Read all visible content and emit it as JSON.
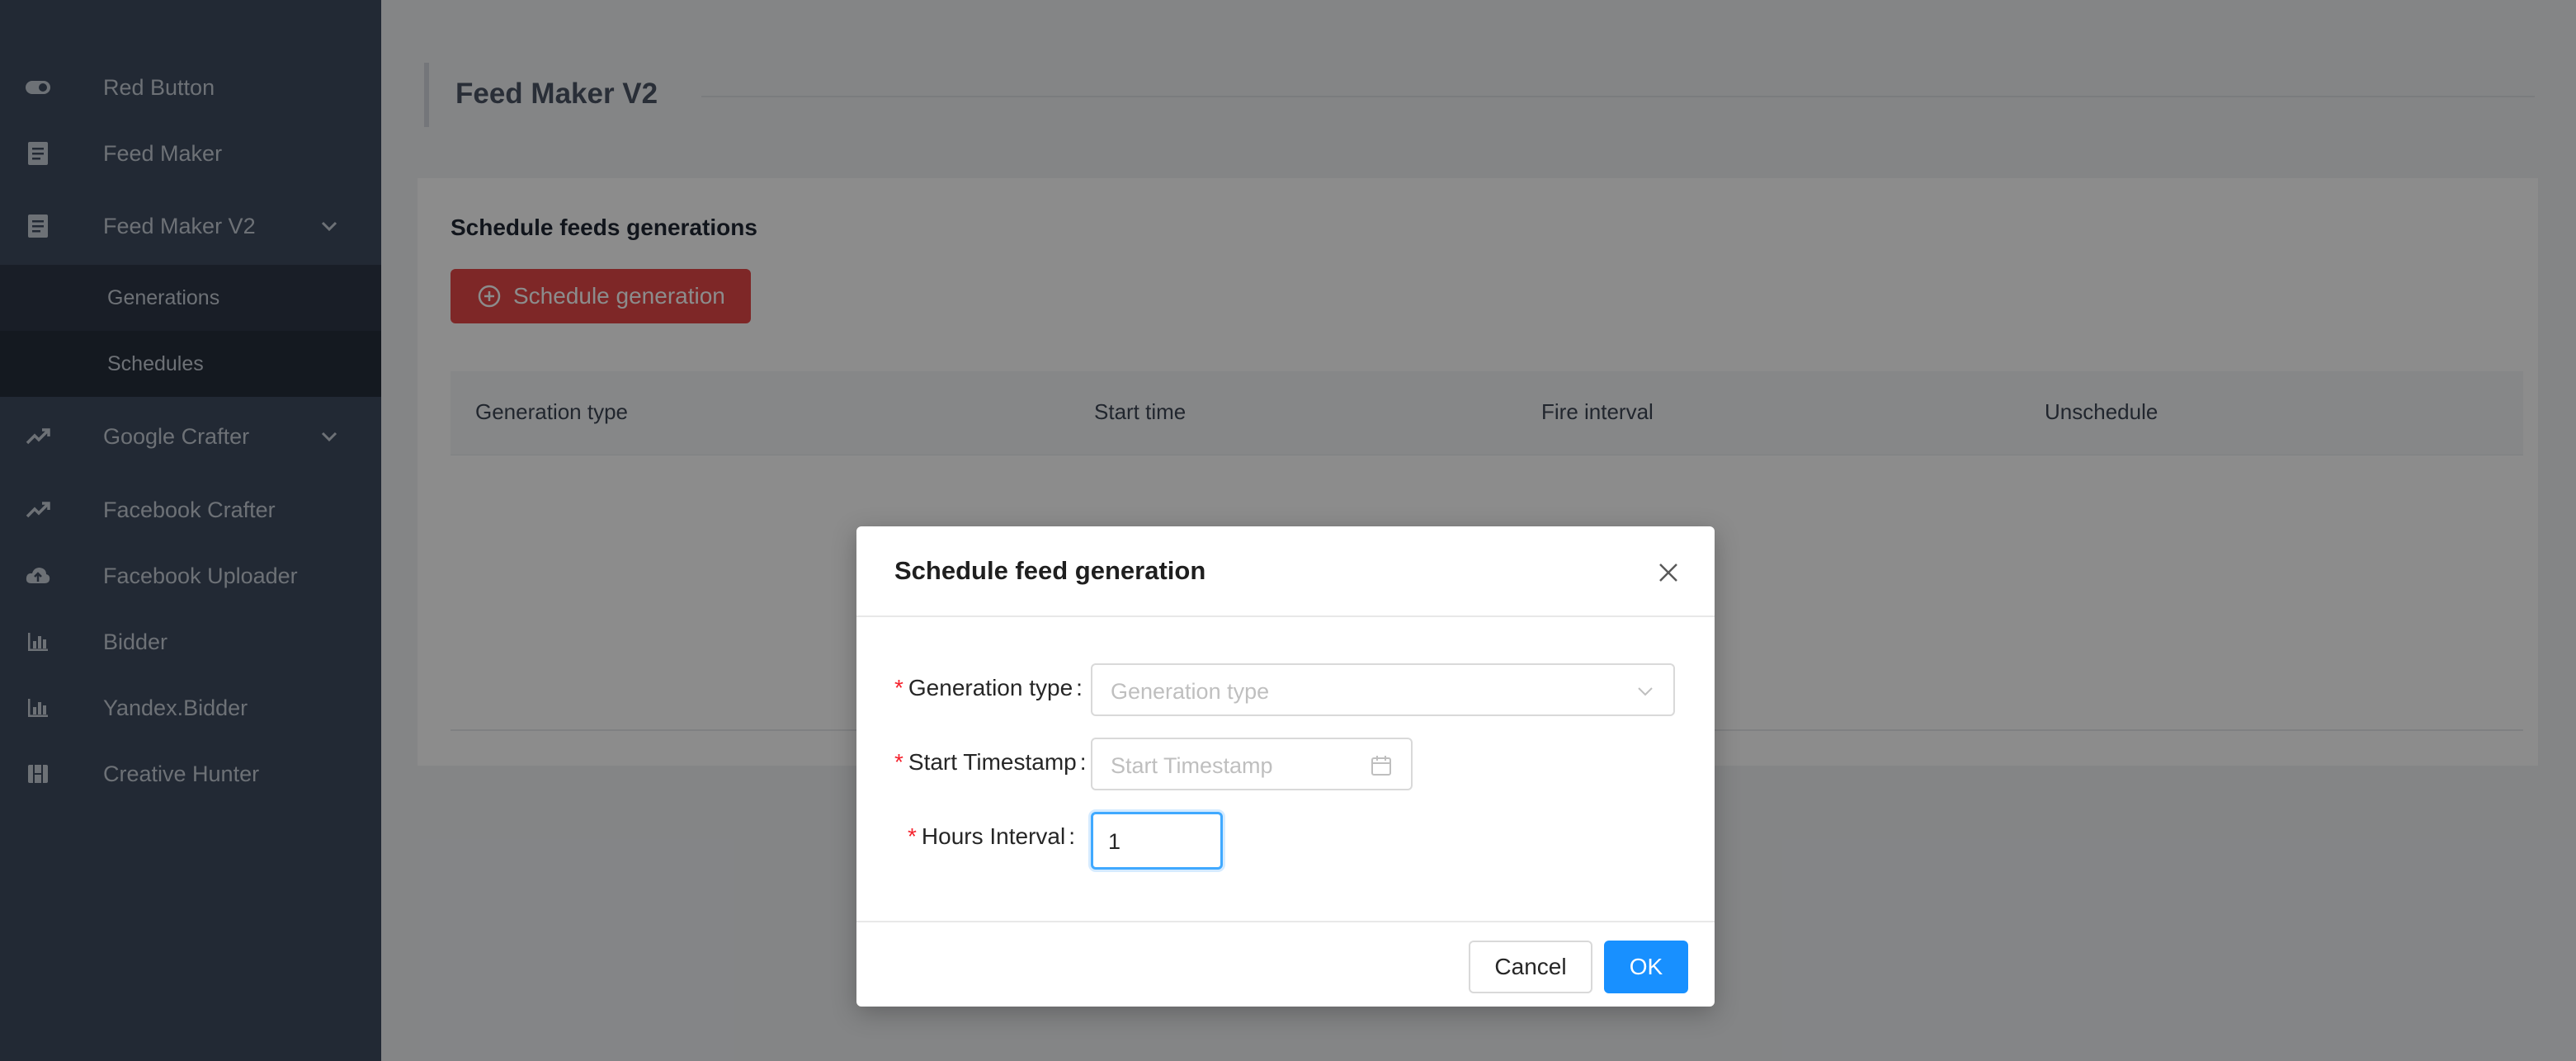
{
  "sidebar": {
    "items": [
      {
        "label": "Red Button",
        "icon": "toggle-icon"
      },
      {
        "label": "Feed Maker",
        "icon": "list-icon"
      },
      {
        "label": "Feed Maker V2",
        "icon": "list-icon",
        "expanded": true
      },
      {
        "label": "Google Crafter",
        "icon": "trend-icon"
      },
      {
        "label": "Facebook Crafter",
        "icon": "trend-icon"
      },
      {
        "label": "Facebook Uploader",
        "icon": "cloud-upload-icon"
      },
      {
        "label": "Bidder",
        "icon": "bar-chart-icon"
      },
      {
        "label": "Yandex.Bidder",
        "icon": "bar-chart-icon"
      },
      {
        "label": "Creative Hunter",
        "icon": "film-icon"
      }
    ],
    "submenu": [
      {
        "label": "Generations"
      },
      {
        "label": "Schedules",
        "active": true
      }
    ]
  },
  "page": {
    "title": "Feed Maker V2",
    "card_title": "Schedule feeds generations",
    "schedule_button": "Schedule generation",
    "table_headers": [
      "Generation type",
      "Start time",
      "Fire interval",
      "Unschedule"
    ]
  },
  "modal": {
    "title": "Schedule feed generation",
    "fields": {
      "generation_type": {
        "label": "Generation type",
        "placeholder": "Generation type"
      },
      "start_timestamp": {
        "label": "Start Timestamp",
        "placeholder": "Start Timestamp"
      },
      "hours_interval": {
        "label": "Hours Interval",
        "value": "1"
      }
    },
    "cancel_label": "Cancel",
    "ok_label": "OK"
  },
  "colors": {
    "sidebar_bg": "#3e4b5f",
    "primary_red": "#e54848",
    "primary_blue": "#1890ff",
    "required_mark": "#f5222d"
  }
}
